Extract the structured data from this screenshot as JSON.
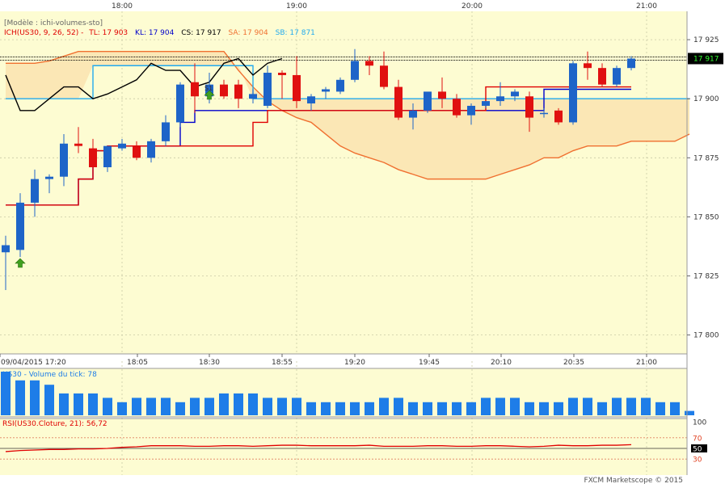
{
  "chart_data": {
    "type": "candlestick",
    "instrument": "US30",
    "top_time_axis": [
      "18:00",
      "19:00",
      "20:00",
      "21:00"
    ],
    "bottom_time_axis": [
      "09/04/2015 17:20",
      "18:05",
      "18:30",
      "18:55",
      "19:20",
      "19:45",
      "20:10",
      "20:35",
      "21:00"
    ],
    "price_axis": [
      "17 925",
      "17 900",
      "17 875",
      "17 850",
      "17 825",
      "17 800"
    ],
    "price_range": [
      17792,
      17937
    ],
    "last_price_label": "17 917",
    "last_price": 17917,
    "model_label": "[Modèle : ichi-volumes-sto]",
    "ichimoku": {
      "prefix": "ICH(US30, 9, 26, 52) -",
      "tl": "TL: 17 903",
      "kl": "KL: 17 904",
      "cs": "CS: 17 917",
      "sa": "SA: 17 904",
      "sb": "SB: 17 871",
      "colors": {
        "tl": "#e00000",
        "kl": "#0000cc",
        "cs": "#000000",
        "sa": "#f07030",
        "sb": "#22aaee"
      }
    },
    "candles": [
      {
        "o": 17835,
        "h": 17842,
        "l": 17819,
        "c": 17838
      },
      {
        "o": 17836,
        "h": 17860,
        "l": 17833,
        "c": 17856
      },
      {
        "o": 17856,
        "h": 17870,
        "l": 17850,
        "c": 17866
      },
      {
        "o": 17866,
        "h": 17868,
        "l": 17860,
        "c": 17867
      },
      {
        "o": 17867,
        "h": 17885,
        "l": 17863,
        "c": 17881
      },
      {
        "o": 17881,
        "h": 17888,
        "l": 17877,
        "c": 17880
      },
      {
        "o": 17879,
        "h": 17883,
        "l": 17870,
        "c": 17871
      },
      {
        "o": 17871,
        "h": 17880,
        "l": 17869,
        "c": 17880
      },
      {
        "o": 17879,
        "h": 17883,
        "l": 17878,
        "c": 17881
      },
      {
        "o": 17880,
        "h": 17882,
        "l": 17874,
        "c": 17875
      },
      {
        "o": 17875,
        "h": 17883,
        "l": 17873,
        "c": 17882
      },
      {
        "o": 17882,
        "h": 17893,
        "l": 17880,
        "c": 17890
      },
      {
        "o": 17890,
        "h": 17907,
        "l": 17888,
        "c": 17906
      },
      {
        "o": 17907,
        "h": 17915,
        "l": 17894,
        "c": 17901
      },
      {
        "o": 17901,
        "h": 17911,
        "l": 17898,
        "c": 17906
      },
      {
        "o": 17906,
        "h": 17908,
        "l": 17900,
        "c": 17901
      },
      {
        "o": 17906,
        "h": 17908,
        "l": 17896,
        "c": 17900
      },
      {
        "o": 17900,
        "h": 17904,
        "l": 17898,
        "c": 17902
      },
      {
        "o": 17897,
        "h": 17914,
        "l": 17896,
        "c": 17911
      },
      {
        "o": 17911,
        "h": 17912,
        "l": 17900,
        "c": 17910
      },
      {
        "o": 17910,
        "h": 17918,
        "l": 17896,
        "c": 17899
      },
      {
        "o": 17898,
        "h": 17902,
        "l": 17895,
        "c": 17901
      },
      {
        "o": 17903,
        "h": 17905,
        "l": 17900,
        "c": 17904
      },
      {
        "o": 17903,
        "h": 17909,
        "l": 17902,
        "c": 17908
      },
      {
        "o": 17908,
        "h": 17921,
        "l": 17907,
        "c": 17916
      },
      {
        "o": 17916,
        "h": 17918,
        "l": 17910,
        "c": 17914
      },
      {
        "o": 17914,
        "h": 17920,
        "l": 17904,
        "c": 17905
      },
      {
        "o": 17905,
        "h": 17908,
        "l": 17891,
        "c": 17892
      },
      {
        "o": 17892,
        "h": 17898,
        "l": 17887,
        "c": 17895
      },
      {
        "o": 17895,
        "h": 17902,
        "l": 17894,
        "c": 17903
      },
      {
        "o": 17903,
        "h": 17909,
        "l": 17896,
        "c": 17900
      },
      {
        "o": 17900,
        "h": 17902,
        "l": 17892,
        "c": 17893
      },
      {
        "o": 17893,
        "h": 17898,
        "l": 17889,
        "c": 17897
      },
      {
        "o": 17897,
        "h": 17899,
        "l": 17896,
        "c": 17899
      },
      {
        "o": 17899,
        "h": 17907,
        "l": 17897,
        "c": 17901
      },
      {
        "o": 17901,
        "h": 17904,
        "l": 17899,
        "c": 17903
      },
      {
        "o": 17901,
        "h": 17903,
        "l": 17886,
        "c": 17892
      },
      {
        "o": 17894,
        "h": 17896,
        "l": 17892,
        "c": 17894
      },
      {
        "o": 17895,
        "h": 17896,
        "l": 17889,
        "c": 17890
      },
      {
        "o": 17890,
        "h": 17916,
        "l": 17889,
        "c": 17915
      },
      {
        "o": 17915,
        "h": 17920,
        "l": 17908,
        "c": 17913
      },
      {
        "o": 17913,
        "h": 17915,
        "l": 17905,
        "c": 17906
      },
      {
        "o": 17906,
        "h": 17914,
        "l": 17905,
        "c": 17913
      },
      {
        "o": 17913,
        "h": 17918,
        "l": 17912,
        "c": 17917
      }
    ],
    "tenkan": [
      17855,
      17855,
      17855,
      17855,
      17855,
      17866,
      17878,
      17880,
      17880,
      17880,
      17880,
      17880,
      17880,
      17880,
      17880,
      17880,
      17880,
      17890,
      17895,
      17895,
      17895,
      17895,
      17895,
      17895,
      17895,
      17895,
      17895,
      17895,
      17895,
      17895,
      17895,
      17895,
      17895,
      17905,
      17905,
      17905,
      17905,
      17905,
      17905,
      17905,
      17905,
      17905,
      17905,
      17905
    ],
    "kijun": [
      17855,
      17855,
      17855,
      17855,
      17855,
      17866,
      17878,
      17880,
      17880,
      17880,
      17880,
      17880,
      17890,
      17895,
      17895,
      17895,
      17895,
      17895,
      17895,
      17895,
      17895,
      17895,
      17895,
      17895,
      17895,
      17895,
      17895,
      17895,
      17895,
      17895,
      17895,
      17895,
      17895,
      17895,
      17895,
      17895,
      17895,
      17904,
      17904,
      17904,
      17904,
      17904,
      17904,
      17904
    ],
    "chikou": [
      17910,
      17895,
      17895,
      17900,
      17905,
      17905,
      17900,
      17902,
      17905,
      17908,
      17915,
      17912,
      17912,
      17905,
      17907,
      17915,
      17917,
      17910,
      17915,
      17917
    ],
    "senkou_a": [
      17915,
      17915,
      17915,
      17916,
      17918,
      17920,
      17920,
      17920,
      17920,
      17920,
      17920,
      17920,
      17920,
      17920,
      17920,
      17920,
      17912,
      17905,
      17899,
      17895,
      17892,
      17890,
      17885,
      17880,
      17877,
      17875,
      17873,
      17870,
      17868,
      17866,
      17866,
      17866,
      17866,
      17866,
      17868,
      17870,
      17872,
      17875,
      17875,
      17878,
      17880,
      17880,
      17880,
      17882,
      17882,
      17882,
      17882,
      17885
    ],
    "senkou_b": [
      17900,
      17900,
      17900,
      17900,
      17900,
      17900,
      17914,
      17914,
      17914,
      17914,
      17914,
      17914,
      17914,
      17914,
      17914,
      17914,
      17914,
      17900,
      17900,
      17900,
      17900,
      17900,
      17900,
      17900,
      17900,
      17900,
      17900,
      17900,
      17900,
      17900,
      17900,
      17900,
      17900,
      17900,
      17900,
      17900,
      17900,
      17900,
      17900,
      17900,
      17900,
      17900,
      17900,
      17900,
      17900,
      17900,
      17900,
      17900
    ],
    "volume_label": "US30 - Volume du tick: 78",
    "volume_color": "#1e7de8",
    "volumes": [
      10,
      8,
      8,
      7,
      5,
      5,
      5,
      4,
      3,
      4,
      4,
      4,
      3,
      4,
      4,
      5,
      5,
      5,
      4,
      4,
      4,
      3,
      3,
      3,
      3,
      3,
      4,
      4,
      3,
      3,
      3,
      3,
      3,
      4,
      4,
      4,
      3,
      3,
      3,
      4,
      4,
      3,
      4,
      4,
      4,
      3,
      3,
      1
    ],
    "rsi_label": "RSI(US30.Cloture, 21): 56,72",
    "rsi_axis": [
      "100",
      "70",
      "50",
      "30"
    ],
    "rsi_values": [
      44,
      46,
      47,
      48,
      48,
      49,
      49,
      50,
      52,
      53,
      55,
      55,
      55,
      54,
      54,
      55,
      55,
      54,
      55,
      56,
      56,
      55,
      55,
      55,
      55,
      56,
      54,
      54,
      54,
      55,
      55,
      54,
      54,
      55,
      55,
      54,
      53,
      54,
      56,
      55,
      55,
      56,
      56,
      57
    ],
    "footer": "FXCM Marketscope © 2015"
  }
}
